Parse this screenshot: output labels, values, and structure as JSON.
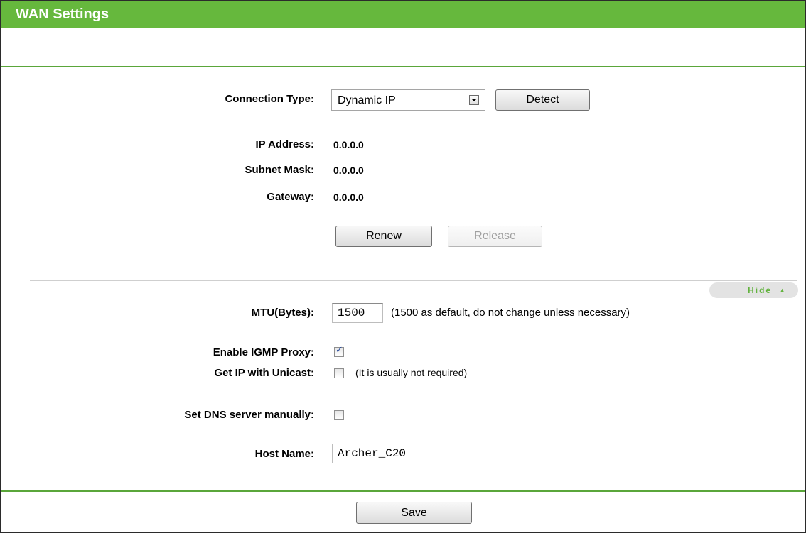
{
  "page": {
    "title": "WAN Settings"
  },
  "wan": {
    "connection_type_label": "Connection Type:",
    "connection_type_value": "Dynamic IP",
    "detect_label": "Detect",
    "ip_address_label": "IP Address:",
    "ip_address_value": "0.0.0.0",
    "subnet_mask_label": "Subnet Mask:",
    "subnet_mask_value": "0.0.0.0",
    "gateway_label": "Gateway:",
    "gateway_value": "0.0.0.0",
    "renew_label": "Renew",
    "release_label": "Release"
  },
  "advanced": {
    "hide_label": "Hide",
    "mtu_label": "MTU(Bytes):",
    "mtu_value": "1500",
    "mtu_note": "(1500 as default, do not change unless necessary)",
    "igmp_label": "Enable IGMP Proxy:",
    "igmp_checked": true,
    "unicast_label": "Get IP with Unicast:",
    "unicast_checked": false,
    "unicast_note": "(It is usually not required)",
    "dns_label": "Set DNS server manually:",
    "dns_checked": false,
    "host_name_label": "Host Name:",
    "host_name_value": "Archer_C20"
  },
  "footer": {
    "save_label": "Save"
  },
  "colors": {
    "accent": "#66b83d",
    "hide_text": "#63b33f"
  }
}
